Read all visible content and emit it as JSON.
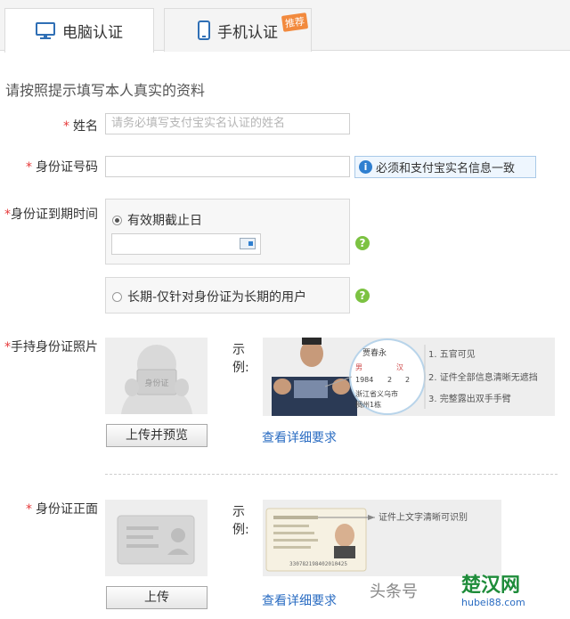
{
  "tabs": [
    {
      "label": "电脑认证",
      "icon": "monitor-icon",
      "active": true
    },
    {
      "label": "手机认证",
      "icon": "phone-icon",
      "active": false,
      "badge": "推荐"
    }
  ],
  "intro": "请按照提示填写本人真实的资料",
  "required_mark": "*",
  "name_field": {
    "label": "姓名",
    "placeholder": "请务必填写支付宝实名认证的姓名"
  },
  "id_field": {
    "label": "身份证号码",
    "value": "",
    "tip": "必须和支付宝实名信息一致",
    "tip_icon": "info-icon"
  },
  "expiry": {
    "label": "身份证到期时间",
    "option_date": "有效期截止日",
    "option_longterm": "长期-仅针对身份证为长期的用户",
    "help_icon": "question-icon"
  },
  "handheld": {
    "label": "手持身份证照片",
    "placeholder_text": "身份证",
    "example_label_1": "示",
    "example_label_2": "例:",
    "upload_button": "上传并预览",
    "detail_link": "查看详细要求",
    "example_card": {
      "name": "贾春永",
      "sex": "男",
      "nation": "汉",
      "year": "1984",
      "month": "2",
      "day": "2",
      "addr1": "浙江省义乌市",
      "addr2": "稠州1栋"
    },
    "requirements": [
      "1. 五官可见",
      "2. 证件全部信息清晰无遮挡",
      "3. 完整露出双手手臂"
    ]
  },
  "front": {
    "label": "身份证正面",
    "example_label_1": "示",
    "example_label_2": "例:",
    "upload_button": "上传",
    "detail_link": "查看详细要求",
    "annotation": "证件上文字清晰可识别",
    "id_number": "330782198402010425"
  },
  "watermark": {
    "text": "头条号",
    "site": "楚汉网",
    "domain": "hubei88.com"
  },
  "colors": {
    "required": "#e6393a",
    "link": "#2a6cc2",
    "help": "#7cc242",
    "badge": "#f28a3e"
  }
}
